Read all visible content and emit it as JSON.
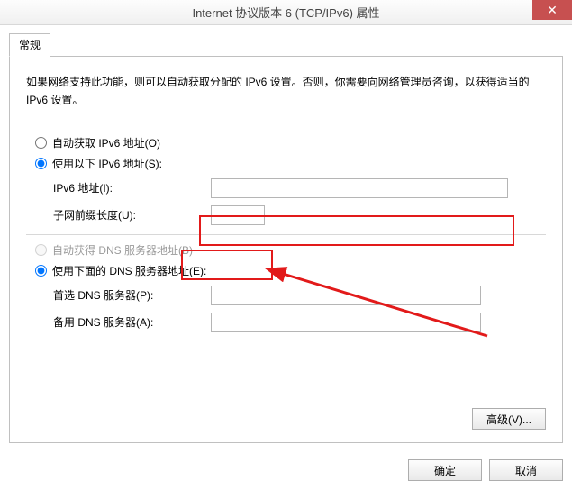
{
  "title": "Internet 协议版本 6 (TCP/IPv6) 属性",
  "tabs": {
    "general": "常规"
  },
  "description": "如果网络支持此功能，则可以自动获取分配的 IPv6 设置。否则，你需要向网络管理员咨询，以获得适当的 IPv6 设置。",
  "radio": {
    "auto_ip": "自动获取 IPv6 地址(O)",
    "manual_ip": "使用以下 IPv6 地址(S):",
    "auto_dns": "自动获得 DNS 服务器地址(B)",
    "manual_dns": "使用下面的 DNS 服务器地址(E):"
  },
  "labels": {
    "ipv6_addr": "IPv6 地址(I):",
    "prefix": "子网前缀长度(U):",
    "pref_dns": "首选 DNS 服务器(P):",
    "alt_dns": "备用 DNS 服务器(A):"
  },
  "values": {
    "ipv6_addr": "",
    "prefix": "",
    "pref_dns": "",
    "alt_dns": ""
  },
  "buttons": {
    "advanced": "高级(V)...",
    "ok": "确定",
    "cancel": "取消"
  }
}
